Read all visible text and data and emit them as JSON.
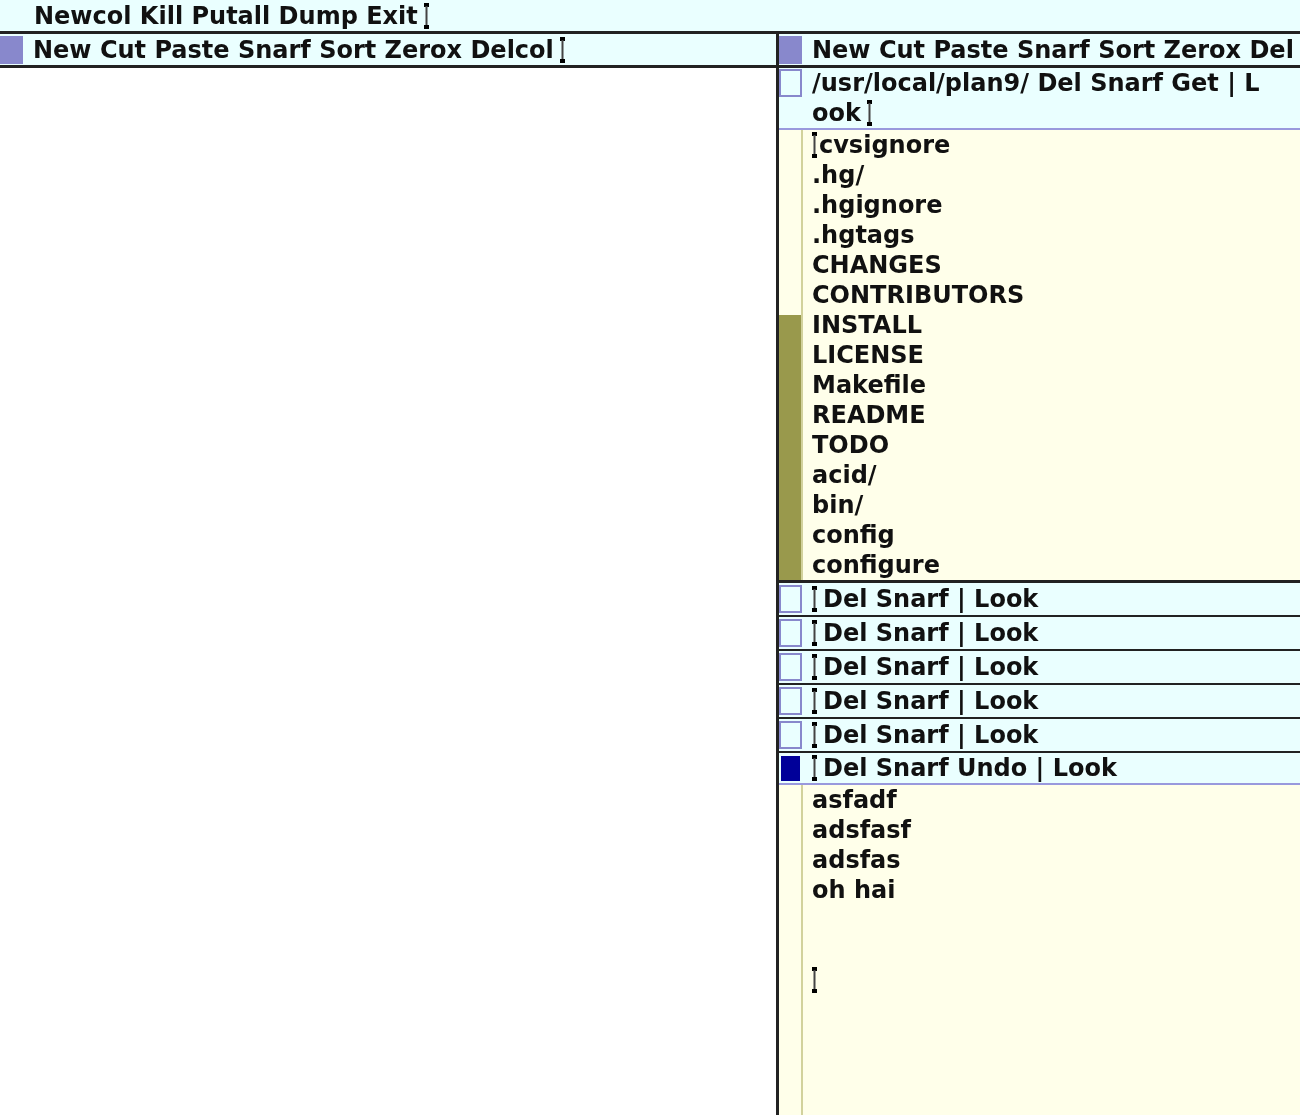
{
  "row_tag": {
    "text": "Newcol Kill Putall Dump Exit",
    "cursor_after": true
  },
  "columns": [
    {
      "tag": {
        "text": "New Cut Paste Snarf Sort Zerox Delcol",
        "cursor_after": true
      }
    },
    {
      "tag": {
        "text": "New Cut Paste Snarf Sort Zerox Del"
      },
      "windows": [
        {
          "tag_lines": [
            "/usr/local/plan9/ Del Snarf Get | L",
            "ook"
          ],
          "cursor_before_tag": false,
          "cursor_after_tag": true,
          "dirty": false,
          "more_below": true,
          "lines": [
            {
              "kind": "text",
              "text": "cvsignore",
              "cursor": true
            },
            {
              "kind": "text",
              "text": ".hg/",
              "cursor": false
            },
            {
              "kind": "text",
              "text": ".hgignore",
              "cursor": false
            },
            {
              "kind": "text",
              "text": ".hgtags",
              "cursor": false
            },
            {
              "kind": "text",
              "text": "CHANGES",
              "cursor": false
            },
            {
              "kind": "text",
              "text": "CONTRIBUTORS",
              "cursor": false
            },
            {
              "kind": "text",
              "text": "INSTALL",
              "cursor": false
            },
            {
              "kind": "text",
              "text": "LICENSE",
              "cursor": false
            },
            {
              "kind": "text",
              "text": "Makefile",
              "cursor": false
            },
            {
              "kind": "text",
              "text": "README",
              "cursor": false
            },
            {
              "kind": "text",
              "text": "TODO",
              "cursor": false
            },
            {
              "kind": "text",
              "text": "acid/",
              "cursor": false
            },
            {
              "kind": "text",
              "text": "bin/",
              "cursor": false
            },
            {
              "kind": "text",
              "text": "config",
              "cursor": false
            },
            {
              "kind": "text",
              "text": "configure",
              "cursor": false
            }
          ]
        },
        {
          "tag_lines": [
            "Del Snarf | Look"
          ],
          "cursor_before_tag": true,
          "cursor_after_tag": false,
          "dirty": false
        },
        {
          "tag_lines": [
            "Del Snarf | Look"
          ],
          "cursor_before_tag": true,
          "cursor_after_tag": false,
          "dirty": false
        },
        {
          "tag_lines": [
            "Del Snarf | Look"
          ],
          "cursor_before_tag": true,
          "cursor_after_tag": false,
          "dirty": false
        },
        {
          "tag_lines": [
            "Del Snarf | Look"
          ],
          "cursor_before_tag": true,
          "cursor_after_tag": false,
          "dirty": false
        },
        {
          "tag_lines": [
            "Del Snarf | Look"
          ],
          "cursor_before_tag": true,
          "cursor_after_tag": false,
          "dirty": false
        },
        {
          "tag_lines": [
            "Del Snarf Undo | Look"
          ],
          "cursor_before_tag": true,
          "cursor_after_tag": false,
          "dirty": true,
          "more_below": false,
          "lines": [
            {
              "kind": "text",
              "text": "asfadf",
              "cursor": false
            },
            {
              "kind": "text",
              "text": "adsfasf",
              "cursor": false
            },
            {
              "kind": "text",
              "text": "adsfas",
              "cursor": false
            },
            {
              "kind": "text",
              "text": "oh hai",
              "cursor": false
            },
            {
              "kind": "blank",
              "cursor": false
            },
            {
              "kind": "blank",
              "cursor": false
            },
            {
              "kind": "blank",
              "cursor": true
            }
          ]
        }
      ]
    }
  ]
}
